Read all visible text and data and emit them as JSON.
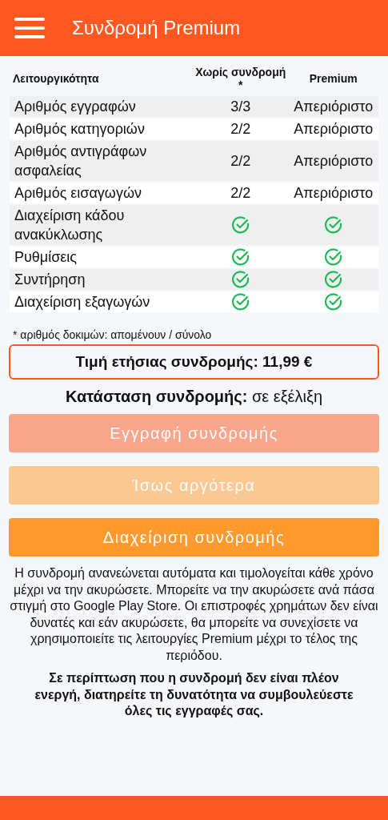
{
  "app_bar": {
    "title": "Συνδρομή Premium"
  },
  "table": {
    "columns": [
      "Λειτουργικότητα",
      "Χωρίς συνδρομή *",
      "Premium"
    ],
    "rows": [
      {
        "label": "Αριθμός εγγραφών",
        "kind": "count",
        "free": "3/3",
        "premium": "Απεριόριστο"
      },
      {
        "label": "Αριθμός κατηγοριών",
        "kind": "count",
        "free": "2/2",
        "premium": "Απεριόριστο"
      },
      {
        "label": "Αριθμός αντιγράφων ασφαλείας",
        "kind": "count",
        "free": "2/2",
        "premium": "Απεριόριστο"
      },
      {
        "label": "Αριθμός εισαγωγών",
        "kind": "count",
        "free": "2/2",
        "premium": "Απεριόριστο"
      },
      {
        "label": "Διαχείριση κάδου ανακύκλωσης",
        "kind": "check"
      },
      {
        "label": "Ρυθμίσεις",
        "kind": "check"
      },
      {
        "label": "Συντήρηση",
        "kind": "check"
      },
      {
        "label": "Διαχείριση εξαγωγών",
        "kind": "check"
      }
    ]
  },
  "footnote": "* αριθμός δοκιμών: απομένουν / σύνολο",
  "price": "Τιμή ετήσιας συνδρομής: 11,99 €",
  "status": {
    "label": "Κατάσταση συνδρομής:",
    "value": "σε εξέλιξη"
  },
  "buttons": [
    {
      "label": "Εγγραφή συνδρομής",
      "kind": "primary",
      "disabled": true
    },
    {
      "label": "Ίσως αργότερα",
      "kind": "secondary",
      "disabled": true
    },
    {
      "label": "Διαχείριση συνδρομής",
      "kind": "secondary",
      "disabled": false
    }
  ],
  "terms": "Η συνδρομή ανανεώνεται αυτόματα και τιμολογείται κάθε χρόνο μέχρι να την ακυρώσετε. Μπορείτε να την ακυρώσετε ανά πάσα στιγμή στο Google Play Store. Οι επιστροφές χρημάτων δεν είναι δυνατές και εάν ακυρώσετε, θα μπορείτε να συνεχίσετε να χρησιμοποιείτε τις λειτουργίες Premium μέχρι το τέλος της περιόδου.",
  "note": "Σε περίπτωση που η συνδρομή δεν είναι πλέον ενεργή, διατηρείτε τη δυνατότητα να συμβουλεύεστε όλες τις εγγραφές σας."
}
